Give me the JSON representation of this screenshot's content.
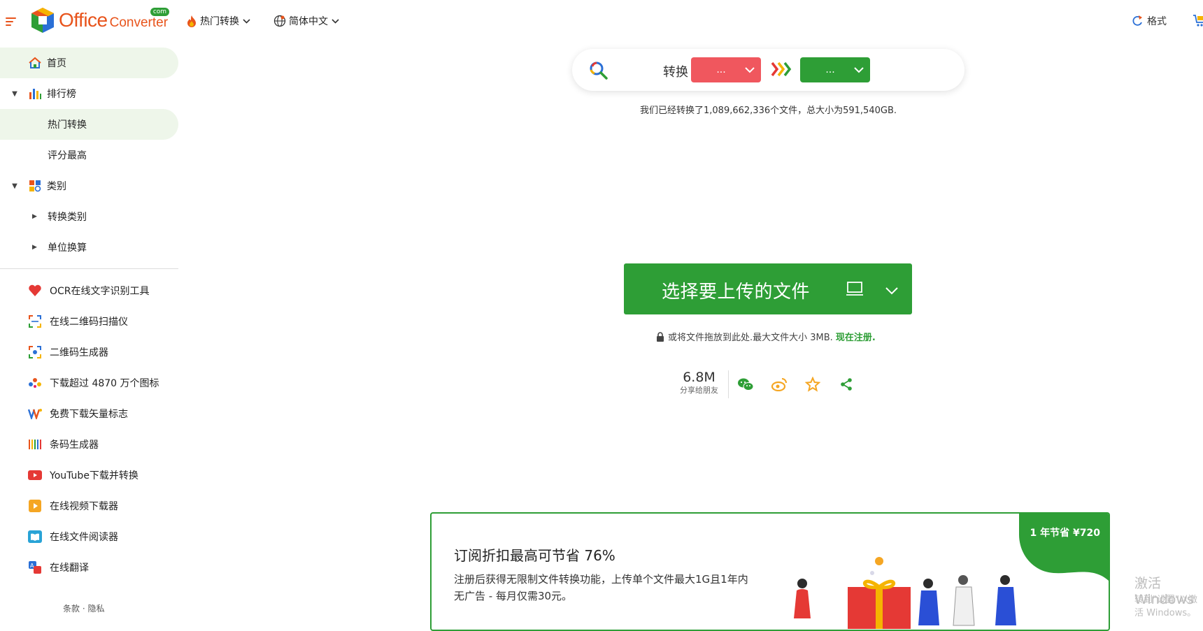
{
  "header": {
    "logo_office": "Office",
    "logo_converter": "Converter",
    "logo_com": "com",
    "nav_popular": "热门转换",
    "nav_language": "简体中文",
    "format_link": "格式"
  },
  "sidebar": {
    "home": "首页",
    "ranking": "排行榜",
    "popular": "热门转换",
    "top_rated": "评分最高",
    "category": "类别",
    "convert_category": "转换类别",
    "unit_convert": "单位换算",
    "tools": [
      {
        "label": "OCR在线文字识别工具",
        "icon": "heart-icon"
      },
      {
        "label": "在线二维码扫描仪",
        "icon": "scan-icon"
      },
      {
        "label": "二维码生成器",
        "icon": "qr-generator-icon"
      },
      {
        "label": "下载超过 4870 万个图标",
        "icon": "icons-icon"
      },
      {
        "label": "免费下载矢量标志",
        "icon": "vector-logo-icon"
      },
      {
        "label": "条码生成器",
        "icon": "barcode-icon"
      },
      {
        "label": "YouTube下载并转换",
        "icon": "youtube-icon"
      },
      {
        "label": "在线视频下载器",
        "icon": "video-download-icon"
      },
      {
        "label": "在线文件阅读器",
        "icon": "file-reader-icon"
      },
      {
        "label": "在线翻译",
        "icon": "translate-icon"
      }
    ],
    "footer": "条款 · 隐私"
  },
  "converter": {
    "convert_label": "转换",
    "from_value": "...",
    "to_value": "...",
    "stats": "我们已经转换了1,089,662,336个文件，总大小为591,540GB."
  },
  "upload": {
    "button_label": "选择要上传的文件",
    "drop_note": "或将文件拖放到此处.最大文件大小 3MB.",
    "register_link": "现在注册."
  },
  "share": {
    "count": "6.8M",
    "sub": "分享给朋友"
  },
  "promo": {
    "title": "订阅折扣最高可节省 76%",
    "desc": "注册后获得无限制文件转换功能，上传单个文件最大1G且1年内无广告 - 每月仅需30元。",
    "badge": "1 年节省 ¥720"
  },
  "watermark": {
    "line1": "激活 Windows",
    "line2": "转到\"设置\"以激活 Windows。"
  },
  "colors": {
    "brand_orange": "#e8541c",
    "brand_green": "#2e9e36",
    "from_red": "#f0575e"
  }
}
